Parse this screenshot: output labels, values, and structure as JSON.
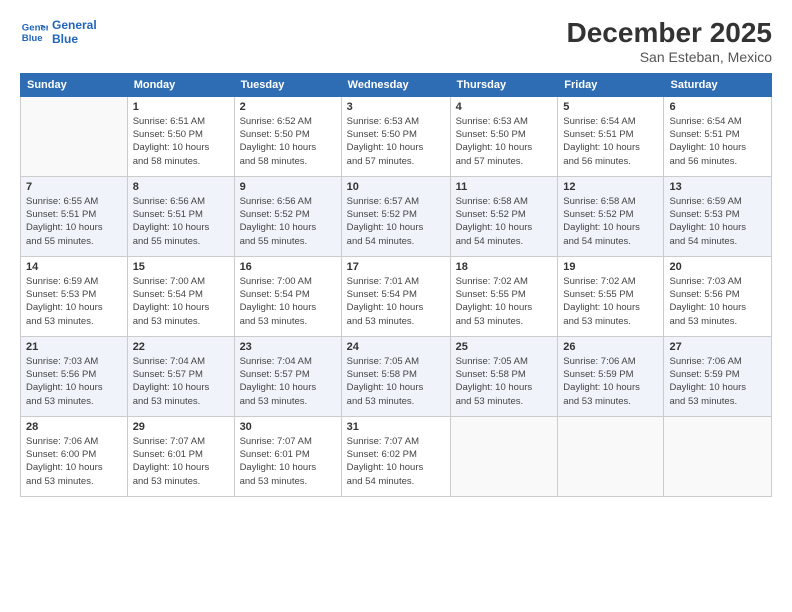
{
  "logo": {
    "line1": "General",
    "line2": "Blue"
  },
  "title": "December 2025",
  "subtitle": "San Esteban, Mexico",
  "days_of_week": [
    "Sunday",
    "Monday",
    "Tuesday",
    "Wednesday",
    "Thursday",
    "Friday",
    "Saturday"
  ],
  "weeks": [
    [
      {
        "day": "",
        "info": ""
      },
      {
        "day": "1",
        "info": "Sunrise: 6:51 AM\nSunset: 5:50 PM\nDaylight: 10 hours\nand 58 minutes."
      },
      {
        "day": "2",
        "info": "Sunrise: 6:52 AM\nSunset: 5:50 PM\nDaylight: 10 hours\nand 58 minutes."
      },
      {
        "day": "3",
        "info": "Sunrise: 6:53 AM\nSunset: 5:50 PM\nDaylight: 10 hours\nand 57 minutes."
      },
      {
        "day": "4",
        "info": "Sunrise: 6:53 AM\nSunset: 5:50 PM\nDaylight: 10 hours\nand 57 minutes."
      },
      {
        "day": "5",
        "info": "Sunrise: 6:54 AM\nSunset: 5:51 PM\nDaylight: 10 hours\nand 56 minutes."
      },
      {
        "day": "6",
        "info": "Sunrise: 6:54 AM\nSunset: 5:51 PM\nDaylight: 10 hours\nand 56 minutes."
      }
    ],
    [
      {
        "day": "7",
        "info": "Sunrise: 6:55 AM\nSunset: 5:51 PM\nDaylight: 10 hours\nand 55 minutes."
      },
      {
        "day": "8",
        "info": "Sunrise: 6:56 AM\nSunset: 5:51 PM\nDaylight: 10 hours\nand 55 minutes."
      },
      {
        "day": "9",
        "info": "Sunrise: 6:56 AM\nSunset: 5:52 PM\nDaylight: 10 hours\nand 55 minutes."
      },
      {
        "day": "10",
        "info": "Sunrise: 6:57 AM\nSunset: 5:52 PM\nDaylight: 10 hours\nand 54 minutes."
      },
      {
        "day": "11",
        "info": "Sunrise: 6:58 AM\nSunset: 5:52 PM\nDaylight: 10 hours\nand 54 minutes."
      },
      {
        "day": "12",
        "info": "Sunrise: 6:58 AM\nSunset: 5:52 PM\nDaylight: 10 hours\nand 54 minutes."
      },
      {
        "day": "13",
        "info": "Sunrise: 6:59 AM\nSunset: 5:53 PM\nDaylight: 10 hours\nand 54 minutes."
      }
    ],
    [
      {
        "day": "14",
        "info": "Sunrise: 6:59 AM\nSunset: 5:53 PM\nDaylight: 10 hours\nand 53 minutes."
      },
      {
        "day": "15",
        "info": "Sunrise: 7:00 AM\nSunset: 5:54 PM\nDaylight: 10 hours\nand 53 minutes."
      },
      {
        "day": "16",
        "info": "Sunrise: 7:00 AM\nSunset: 5:54 PM\nDaylight: 10 hours\nand 53 minutes."
      },
      {
        "day": "17",
        "info": "Sunrise: 7:01 AM\nSunset: 5:54 PM\nDaylight: 10 hours\nand 53 minutes."
      },
      {
        "day": "18",
        "info": "Sunrise: 7:02 AM\nSunset: 5:55 PM\nDaylight: 10 hours\nand 53 minutes."
      },
      {
        "day": "19",
        "info": "Sunrise: 7:02 AM\nSunset: 5:55 PM\nDaylight: 10 hours\nand 53 minutes."
      },
      {
        "day": "20",
        "info": "Sunrise: 7:03 AM\nSunset: 5:56 PM\nDaylight: 10 hours\nand 53 minutes."
      }
    ],
    [
      {
        "day": "21",
        "info": "Sunrise: 7:03 AM\nSunset: 5:56 PM\nDaylight: 10 hours\nand 53 minutes."
      },
      {
        "day": "22",
        "info": "Sunrise: 7:04 AM\nSunset: 5:57 PM\nDaylight: 10 hours\nand 53 minutes."
      },
      {
        "day": "23",
        "info": "Sunrise: 7:04 AM\nSunset: 5:57 PM\nDaylight: 10 hours\nand 53 minutes."
      },
      {
        "day": "24",
        "info": "Sunrise: 7:05 AM\nSunset: 5:58 PM\nDaylight: 10 hours\nand 53 minutes."
      },
      {
        "day": "25",
        "info": "Sunrise: 7:05 AM\nSunset: 5:58 PM\nDaylight: 10 hours\nand 53 minutes."
      },
      {
        "day": "26",
        "info": "Sunrise: 7:06 AM\nSunset: 5:59 PM\nDaylight: 10 hours\nand 53 minutes."
      },
      {
        "day": "27",
        "info": "Sunrise: 7:06 AM\nSunset: 5:59 PM\nDaylight: 10 hours\nand 53 minutes."
      }
    ],
    [
      {
        "day": "28",
        "info": "Sunrise: 7:06 AM\nSunset: 6:00 PM\nDaylight: 10 hours\nand 53 minutes."
      },
      {
        "day": "29",
        "info": "Sunrise: 7:07 AM\nSunset: 6:01 PM\nDaylight: 10 hours\nand 53 minutes."
      },
      {
        "day": "30",
        "info": "Sunrise: 7:07 AM\nSunset: 6:01 PM\nDaylight: 10 hours\nand 53 minutes."
      },
      {
        "day": "31",
        "info": "Sunrise: 7:07 AM\nSunset: 6:02 PM\nDaylight: 10 hours\nand 54 minutes."
      },
      {
        "day": "",
        "info": ""
      },
      {
        "day": "",
        "info": ""
      },
      {
        "day": "",
        "info": ""
      }
    ]
  ]
}
